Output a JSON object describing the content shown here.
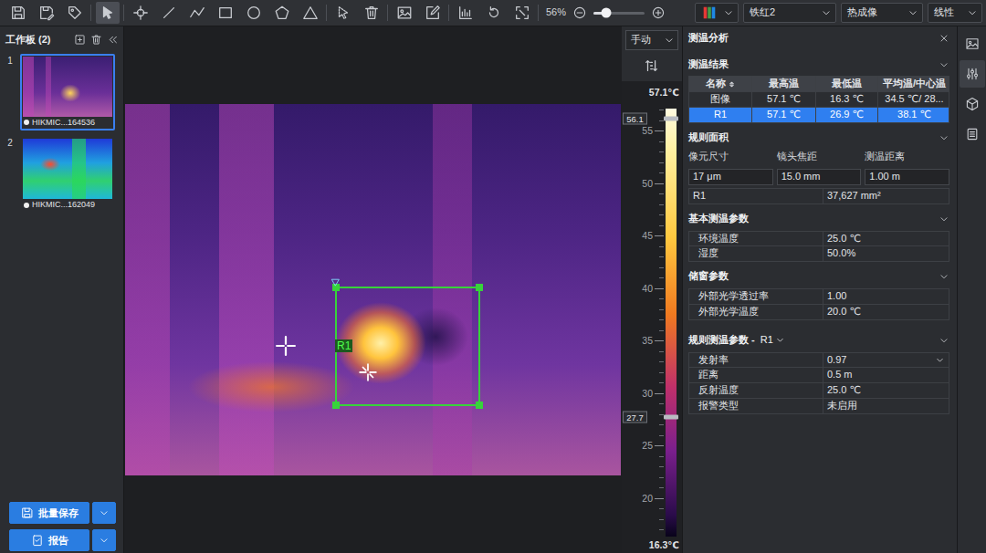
{
  "toolbar": {
    "tools": [
      {
        "selected": false
      },
      {
        "selected": false
      },
      {
        "selected": false
      },
      {
        "selected": true
      },
      {
        "selected": false
      },
      {
        "selected": false
      },
      {
        "selected": false
      },
      {
        "selected": false
      },
      {
        "selected": false
      },
      {
        "selected": false
      },
      {
        "selected": false
      },
      {
        "selected": false
      },
      {
        "selected": false
      },
      {
        "selected": false
      },
      {
        "selected": false
      },
      {
        "selected": false
      },
      {
        "selected": false
      },
      {
        "selected": false
      }
    ],
    "zoom": {
      "reading": "56%",
      "level": 0.25
    },
    "dropdowns": [
      {
        "label": "铁红2"
      },
      {
        "label": "热成像"
      },
      {
        "label": "线性"
      }
    ]
  },
  "workboard": {
    "title": "工作板 (2)",
    "items": [
      {
        "index": "1",
        "label": "HIKMIC...164536",
        "selected": true
      },
      {
        "index": "2",
        "label": "HIKMIC...162049",
        "selected": false
      }
    ],
    "buttons": [
      {
        "label": "批量保存"
      },
      {
        "label": "报告"
      }
    ]
  },
  "image": {
    "rule": {
      "label": "R1",
      "selected": true
    }
  },
  "scale": {
    "mode": "手动",
    "max_label": "57.1℃",
    "min_label": "16.3℃",
    "range": [
      16.3,
      57.1
    ],
    "ticks": [
      {
        "label": "55",
        "value": 55
      },
      {
        "label": "50",
        "value": 50
      },
      {
        "label": "45",
        "value": 45
      },
      {
        "label": "40",
        "value": 40
      },
      {
        "label": "35",
        "value": 35
      },
      {
        "label": "30",
        "value": 30
      },
      {
        "label": "25",
        "value": 25
      },
      {
        "label": "20",
        "value": 20
      }
    ],
    "markers": [
      {
        "label": "56.1",
        "value": 56.1
      },
      {
        "label": "27.7",
        "value": 27.7
      }
    ]
  },
  "analysis": {
    "title": "测温分析",
    "results": {
      "title": "测温结果",
      "columns": [
        "名称",
        "最高温",
        "最低温",
        "平均温/中心温"
      ],
      "rows": [
        {
          "cells": [
            "图像",
            "57.1 ℃",
            "16.3 ℃",
            "34.5 ℃/ 28..."
          ],
          "selected": false
        },
        {
          "cells": [
            "R1",
            "57.1 ℃",
            "26.9 ℃",
            "38.1 ℃"
          ],
          "selected": true
        }
      ]
    },
    "area": {
      "title": "规则面积",
      "labels": [
        "像元尺寸",
        "镜头焦距",
        "测温距离"
      ],
      "values": [
        "17 μm",
        "15.0 mm",
        "1.00 m"
      ],
      "rows": [
        {
          "name": "R1",
          "value": "37,627 mm²"
        }
      ]
    },
    "basic": {
      "title": "基本测温参数",
      "params": [
        {
          "label": "环境温度",
          "value": "25.0 ℃"
        },
        {
          "label": "湿度",
          "value": "50.0%"
        }
      ]
    },
    "window_params": {
      "title": "储窗参数",
      "params": [
        {
          "label": "外部光学透过率",
          "value": "1.00"
        },
        {
          "label": "外部光学温度",
          "value": "20.0 ℃"
        }
      ]
    },
    "rule_params": {
      "title": "规则测温参数 -",
      "rule": "R1",
      "params": [
        {
          "label": "发射率",
          "value": "0.97",
          "kind": "dropdown"
        },
        {
          "label": "距离",
          "value": "0.5 m",
          "kind": "text"
        },
        {
          "label": "反射温度",
          "value": "25.0 ℃",
          "kind": "text"
        },
        {
          "label": "报警类型",
          "value": "未启用",
          "kind": "text"
        }
      ]
    }
  },
  "side_tabs": [
    {
      "selected": false
    },
    {
      "selected": true
    },
    {
      "selected": false
    },
    {
      "selected": false
    }
  ]
}
